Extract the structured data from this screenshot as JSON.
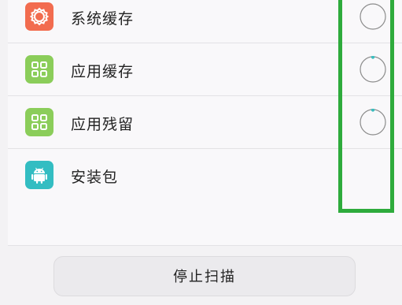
{
  "items": [
    {
      "label": "系统缓存",
      "icon": "gear-icon",
      "icon_color": "#f26c4f",
      "status": "empty-circle"
    },
    {
      "label": "应用缓存",
      "icon": "apps-grid-icon",
      "icon_color": "#8bcd5a",
      "status": "scanning"
    },
    {
      "label": "应用残留",
      "icon": "apps-grid-icon",
      "icon_color": "#8bcd5a",
      "status": "scanning"
    },
    {
      "label": "安装包",
      "icon": "android-icon",
      "icon_color": "#33bdc2",
      "status": "none"
    }
  ],
  "stop_button_label": "停止扫描",
  "colors": {
    "highlight": "#2eab3c",
    "spinner_dot": "#3bbdbe"
  }
}
